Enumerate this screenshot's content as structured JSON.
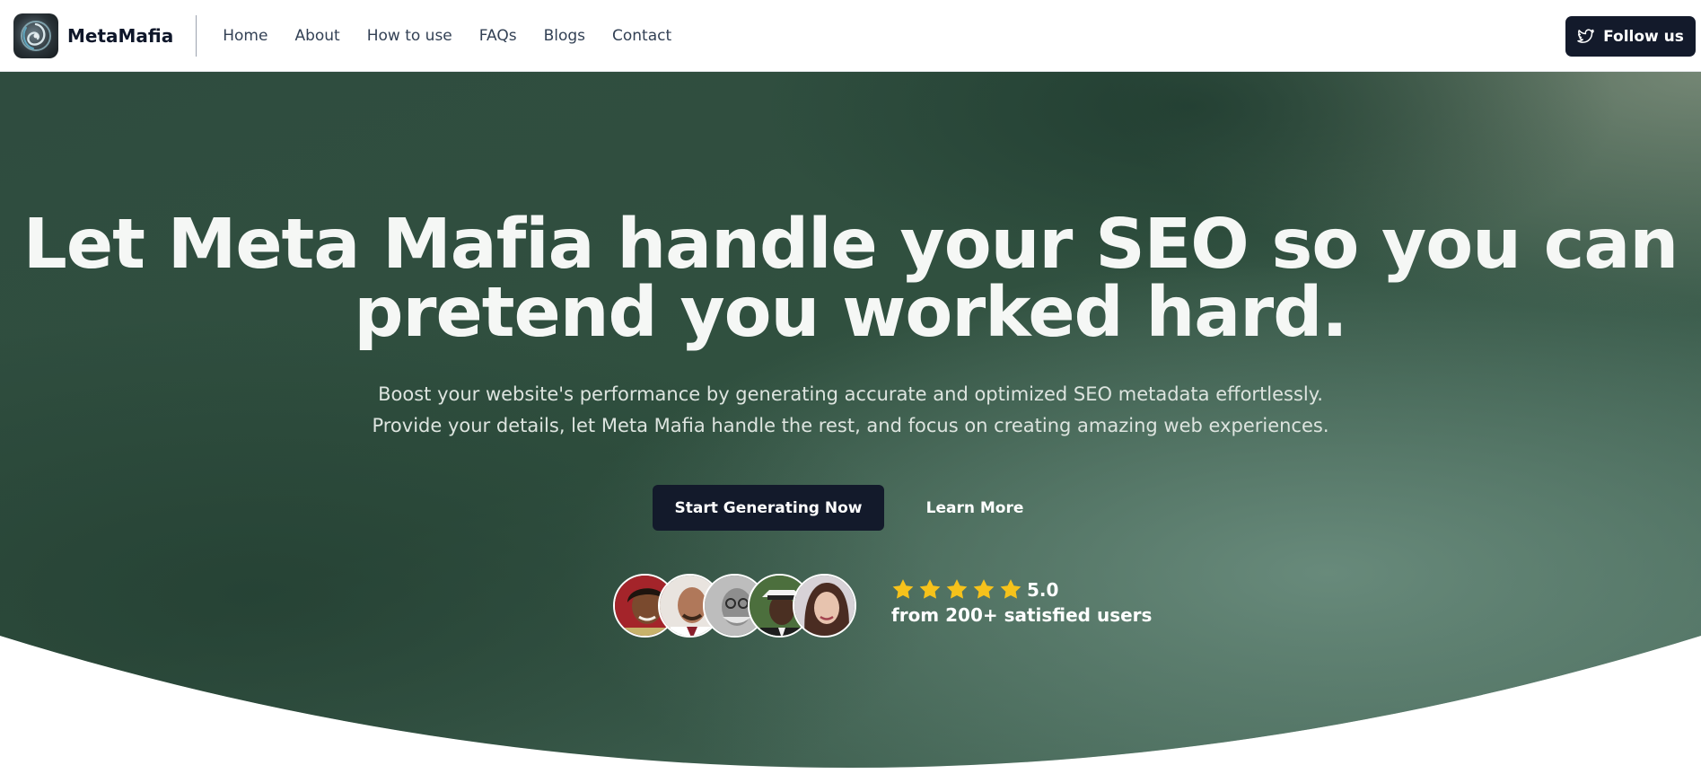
{
  "brand": {
    "name": "MetaMafia",
    "logo_icon": "swirl-logo-icon"
  },
  "nav": {
    "items": [
      {
        "label": "Home"
      },
      {
        "label": "About"
      },
      {
        "label": "How to use"
      },
      {
        "label": "FAQs"
      },
      {
        "label": "Blogs"
      },
      {
        "label": "Contact"
      }
    ],
    "follow_label": "Follow us",
    "follow_icon": "twitter-bird-icon"
  },
  "hero": {
    "title": "Let Meta Mafia handle your SEO so you can pretend you worked hard.",
    "subtitle_line1": "Boost your website's performance by generating accurate and optimized SEO metadata effortlessly.",
    "subtitle_line2": "Provide your details, let Meta Mafia handle the rest, and focus on creating amazing web experiences.",
    "primary_cta": "Start Generating Now",
    "secondary_cta": "Learn More",
    "rating": {
      "value": "5.0",
      "stars": 5,
      "caption": "from 200+ satisfied users"
    },
    "avatar_count": 5
  },
  "colors": {
    "hero_dark": "#2b4a3d",
    "hero_light": "#5e7f70",
    "button_dark": "#131a2b",
    "star": "#f6c21b"
  }
}
